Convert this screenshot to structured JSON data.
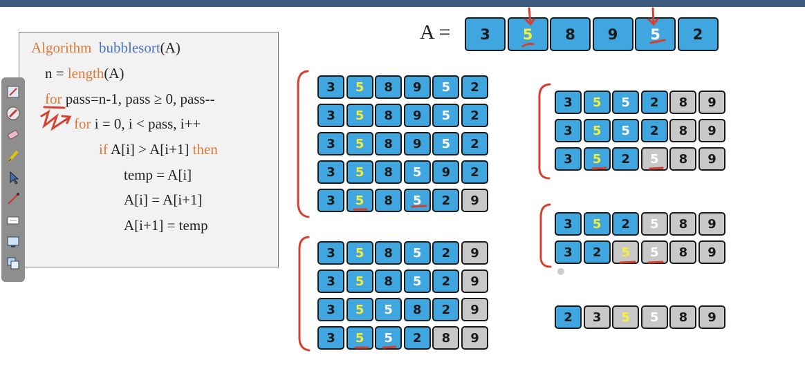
{
  "pseudocode": [
    {
      "parts": [
        {
          "t": "Algorithm  ",
          "c": "kw"
        },
        {
          "t": "bubblesort",
          "c": "fn"
        },
        {
          "t": "(A)",
          "c": ""
        }
      ]
    },
    {
      "parts": [
        {
          "t": "n = ",
          "c": ""
        },
        {
          "t": "length",
          "c": "kw"
        },
        {
          "t": "(A)",
          "c": ""
        }
      ]
    },
    {
      "parts": [
        {
          "t": "for",
          "c": "kw"
        },
        {
          "t": " pass=n-1, pass ≥ 0, pass--",
          "c": ""
        }
      ]
    },
    {
      "parts": [
        {
          "t": "for",
          "c": "kw"
        },
        {
          "t": " i = 0, i < pass, i++",
          "c": ""
        }
      ]
    },
    {
      "parts": [
        {
          "t": "if",
          "c": "kw"
        },
        {
          "t": " A[i] > A[i+1] ",
          "c": ""
        },
        {
          "t": "then",
          "c": "kw"
        }
      ]
    },
    {
      "parts": [
        {
          "t": "temp = A[i]",
          "c": ""
        }
      ]
    },
    {
      "parts": [
        {
          "t": "A[i] = A[i+1]",
          "c": ""
        }
      ]
    },
    {
      "parts": [
        {
          "t": "A[i+1] = temp",
          "c": ""
        }
      ]
    }
  ],
  "toolbar_icons": [
    "pen-icon",
    "marker-icon",
    "eraser-icon",
    "highlighter-icon",
    "pointer-icon",
    "line-icon",
    "whiteboard-icon",
    "screen-icon",
    "capture-icon"
  ],
  "array_label": "A =",
  "colors": {
    "blue": "#3fa6e0",
    "gray": "#c8c8c8",
    "yellow_text": "#f4ef3a",
    "white_text": "#ffffff",
    "annotation": "#d6402f"
  },
  "initial_array": [
    {
      "v": "3",
      "bg": "b",
      "t": "d"
    },
    {
      "v": "5",
      "bg": "b",
      "t": "y"
    },
    {
      "v": "8",
      "bg": "b",
      "t": "d"
    },
    {
      "v": "9",
      "bg": "b",
      "t": "d"
    },
    {
      "v": "5",
      "bg": "b",
      "t": "w"
    },
    {
      "v": "2",
      "bg": "b",
      "t": "d"
    }
  ],
  "pass_groups": [
    {
      "name": "pass-1",
      "rows": [
        [
          "3b",
          "5by",
          "8b",
          "9b",
          "5bw",
          "2b"
        ],
        [
          "3b",
          "5by",
          "8b",
          "9b",
          "5bw",
          "2b"
        ],
        [
          "3b",
          "5by",
          "8b",
          "9b",
          "5bw",
          "2b"
        ],
        [
          "3b",
          "5by",
          "8b",
          "5bw",
          "9b",
          "2b"
        ],
        [
          "3b",
          "5by",
          "8b",
          "5bw",
          "2b",
          "9g"
        ]
      ]
    },
    {
      "name": "pass-2",
      "rows": [
        [
          "3b",
          "5by",
          "8b",
          "5bw",
          "2b",
          "9g"
        ],
        [
          "3b",
          "5by",
          "8b",
          "5bw",
          "2b",
          "9g"
        ],
        [
          "3b",
          "5by",
          "5bw",
          "8b",
          "2b",
          "9g"
        ],
        [
          "3b",
          "5by",
          "5bw",
          "2b",
          "8g",
          "9g"
        ]
      ]
    },
    {
      "name": "pass-3",
      "rows": [
        [
          "3b",
          "5by",
          "5bw",
          "2b",
          "8g",
          "9g"
        ],
        [
          "3b",
          "5by",
          "5bw",
          "2b",
          "8g",
          "9g"
        ],
        [
          "3b",
          "5by",
          "2b",
          "5gw",
          "8g",
          "9g"
        ]
      ]
    },
    {
      "name": "pass-4",
      "rows": [
        [
          "3b",
          "5by",
          "2b",
          "5gw",
          "8g",
          "9g"
        ],
        [
          "3b",
          "2b",
          "5gy",
          "5gw",
          "8g",
          "9g"
        ]
      ]
    },
    {
      "name": "pass-5",
      "rows": [
        [
          "2b",
          "3g",
          "5gy",
          "5gw",
          "8g",
          "9g"
        ]
      ]
    }
  ]
}
